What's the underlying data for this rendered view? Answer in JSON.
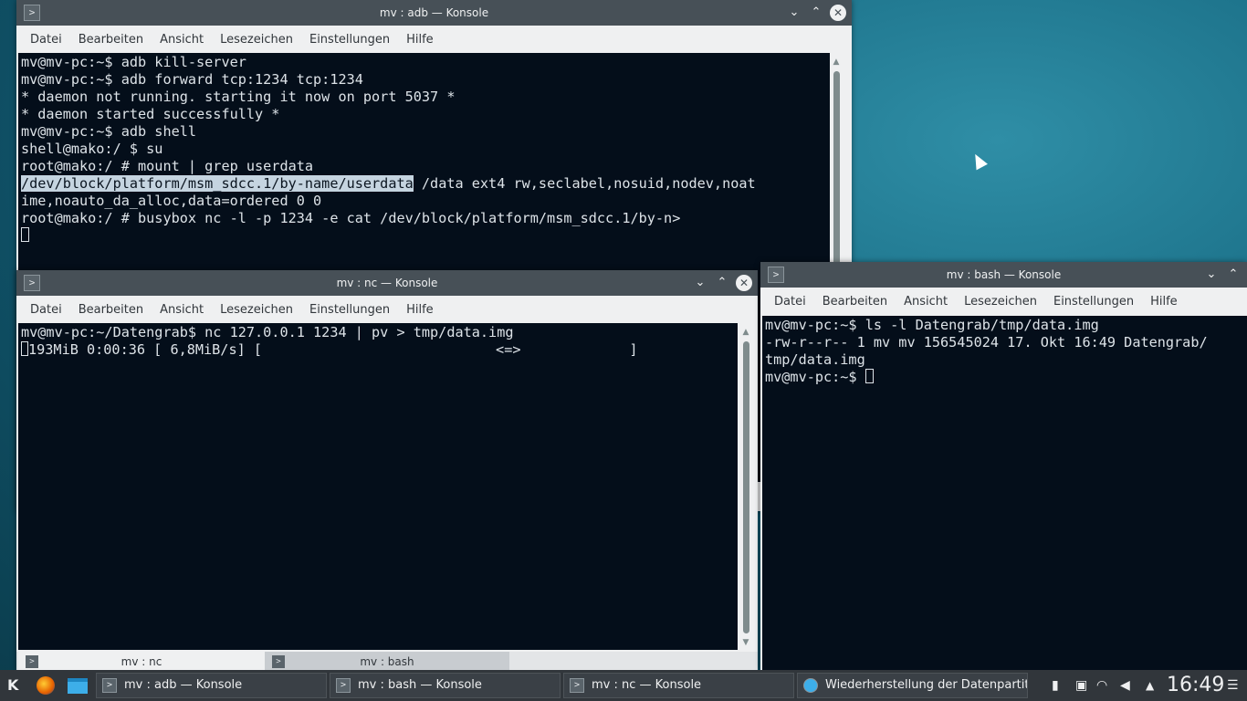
{
  "menus": [
    "Datei",
    "Bearbeiten",
    "Ansicht",
    "Lesezeichen",
    "Einstellungen",
    "Hilfe"
  ],
  "windows": {
    "adb": {
      "title": "mv : adb — Konsole",
      "lines": [
        "mv@mv-pc:~$ adb kill-server",
        "mv@mv-pc:~$ adb forward tcp:1234 tcp:1234",
        "* daemon not running. starting it now on port 5037 *",
        "* daemon started successfully *",
        "mv@mv-pc:~$ adb shell",
        "shell@mako:/ $ su",
        "root@mako:/ # mount | grep userdata"
      ],
      "selected_text": "/dev/block/platform/msm_sdcc.1/by-name/userdata",
      "selected_rest": " /data ext4 rw,seclabel,nosuid,nodev,noat",
      "lines_after": [
        "ime,noauto_da_alloc,data=ordered 0 0",
        "root@mako:/ # busybox nc -l -p 1234 -e cat /dev/block/platform/msm_sdcc.1/by-n>"
      ]
    },
    "nc": {
      "title": "mv : nc — Konsole",
      "line1": "mv@mv-pc:~/Datengrab$ nc 127.0.0.1 1234 | pv > tmp/data.img",
      "line2": "193MiB 0:00:36 [ 6,8MiB/s] [                            <=>             ]",
      "tabs": [
        "mv : nc",
        "mv : bash"
      ]
    },
    "bash": {
      "title": "mv : bash — Konsole",
      "lines": [
        "mv@mv-pc:~$ ls -l Datengrab/tmp/data.img",
        "-rw-r--r-- 1 mv mv 156545024 17. Okt 16:49 Datengrab/",
        "tmp/data.img"
      ],
      "prompt": "mv@mv-pc:~$ "
    }
  },
  "taskbar": {
    "tasks": [
      "mv : adb — Konsole",
      "mv : bash — Konsole",
      "mv : nc — Konsole",
      "Wiederherstellung der Datenpartiti"
    ],
    "clock": "16:49"
  }
}
